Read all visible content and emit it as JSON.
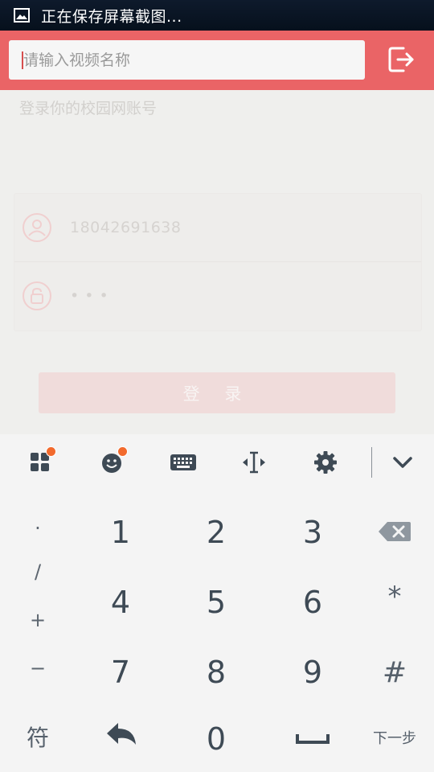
{
  "status_bar": {
    "text": "正在保存屏幕截图...",
    "icon": "image-icon"
  },
  "header": {
    "search_placeholder": "请输入视频名称",
    "logout_icon": "logout-icon",
    "colors": {
      "header_bg": "#ea6466"
    }
  },
  "login": {
    "hint": "登录你的校园网账号",
    "username": "18042691638",
    "password_mask": "• • •",
    "button_label": "登 录",
    "user_icon": "user-icon",
    "lock_icon": "lock-icon"
  },
  "keyboard": {
    "toolbar": [
      "apps-icon",
      "emoji-icon",
      "keyboard-icon",
      "cursor-icon",
      "settings-icon",
      "chevron-down-icon"
    ],
    "left_symbols": [
      "·",
      "/",
      "+",
      "−"
    ],
    "digits": [
      "1",
      "2",
      "3",
      "4",
      "5",
      "6",
      "7",
      "8",
      "9",
      "0"
    ],
    "star": "*",
    "hash": "#",
    "fu_label": "符",
    "next_label": "下一步",
    "backspace_icon": "backspace-icon",
    "undo_icon": "undo-icon",
    "space_icon": "space-icon"
  }
}
